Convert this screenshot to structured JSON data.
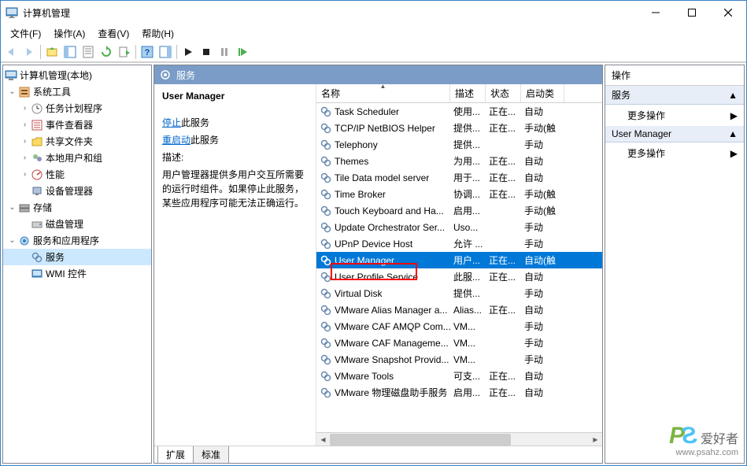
{
  "window": {
    "title": "计算机管理"
  },
  "menu": {
    "file": "文件(F)",
    "action": "操作(A)",
    "view": "查看(V)",
    "help": "帮助(H)"
  },
  "tree": {
    "root": "计算机管理(本地)",
    "groups": [
      {
        "label": "系统工具",
        "expanded": true,
        "children": [
          {
            "label": "任务计划程序"
          },
          {
            "label": "事件查看器"
          },
          {
            "label": "共享文件夹"
          },
          {
            "label": "本地用户和组"
          },
          {
            "label": "性能"
          },
          {
            "label": "设备管理器"
          }
        ]
      },
      {
        "label": "存储",
        "expanded": true,
        "children": [
          {
            "label": "磁盘管理"
          }
        ]
      },
      {
        "label": "服务和应用程序",
        "expanded": true,
        "children": [
          {
            "label": "服务",
            "selected": true
          },
          {
            "label": "WMI 控件"
          }
        ]
      }
    ]
  },
  "center": {
    "header_label": "服务",
    "selected_name": "User Manager",
    "action_stop_link": "停止",
    "action_stop_suffix": "此服务",
    "action_restart_link": "重启动",
    "action_restart_suffix": "此服务",
    "desc_label": "描述:",
    "desc_text": "用户管理器提供多用户交互所需要的运行时组件。如果停止此服务，某些应用程序可能无法正确运行。",
    "cols": {
      "name": "名称",
      "desc": "描述",
      "status": "状态",
      "start": "启动类"
    },
    "services": [
      {
        "name": "Task Scheduler",
        "desc": "使用...",
        "status": "正在...",
        "start": "自动"
      },
      {
        "name": "TCP/IP NetBIOS Helper",
        "desc": "提供...",
        "status": "正在...",
        "start": "手动(触"
      },
      {
        "name": "Telephony",
        "desc": "提供...",
        "status": "",
        "start": "手动"
      },
      {
        "name": "Themes",
        "desc": "为用...",
        "status": "正在...",
        "start": "自动"
      },
      {
        "name": "Tile Data model server",
        "desc": "用于...",
        "status": "正在...",
        "start": "自动"
      },
      {
        "name": "Time Broker",
        "desc": "协调...",
        "status": "正在...",
        "start": "手动(触"
      },
      {
        "name": "Touch Keyboard and Ha...",
        "desc": "启用...",
        "status": "",
        "start": "手动(触"
      },
      {
        "name": "Update Orchestrator Ser...",
        "desc": "Uso...",
        "status": "",
        "start": "手动"
      },
      {
        "name": "UPnP Device Host",
        "desc": "允许 ...",
        "status": "",
        "start": "手动"
      },
      {
        "name": "User Manager",
        "desc": "用户...",
        "status": "正在...",
        "start": "自动(触",
        "selected": true
      },
      {
        "name": "User Profile Service",
        "desc": "此服...",
        "status": "正在...",
        "start": "自动"
      },
      {
        "name": "Virtual Disk",
        "desc": "提供...",
        "status": "",
        "start": "手动"
      },
      {
        "name": "VMware Alias Manager a...",
        "desc": "Alias...",
        "status": "正在...",
        "start": "自动"
      },
      {
        "name": "VMware CAF AMQP Com...",
        "desc": "VM...",
        "status": "",
        "start": "手动"
      },
      {
        "name": "VMware CAF Manageme...",
        "desc": "VM...",
        "status": "",
        "start": "手动"
      },
      {
        "name": "VMware Snapshot Provid...",
        "desc": "VM...",
        "status": "",
        "start": "手动"
      },
      {
        "name": "VMware Tools",
        "desc": "可支...",
        "status": "正在...",
        "start": "自动"
      },
      {
        "name": "VMware 物理磁盘助手服务",
        "desc": "启用...",
        "status": "正在...",
        "start": "自动"
      }
    ],
    "tabs": {
      "extended": "扩展",
      "standard": "标准"
    }
  },
  "actions": {
    "title": "操作",
    "section1": "服务",
    "item_more": "更多操作",
    "section2": "User Manager"
  },
  "watermark": {
    "txt": "爱好者",
    "url": "www.psahz.com"
  }
}
